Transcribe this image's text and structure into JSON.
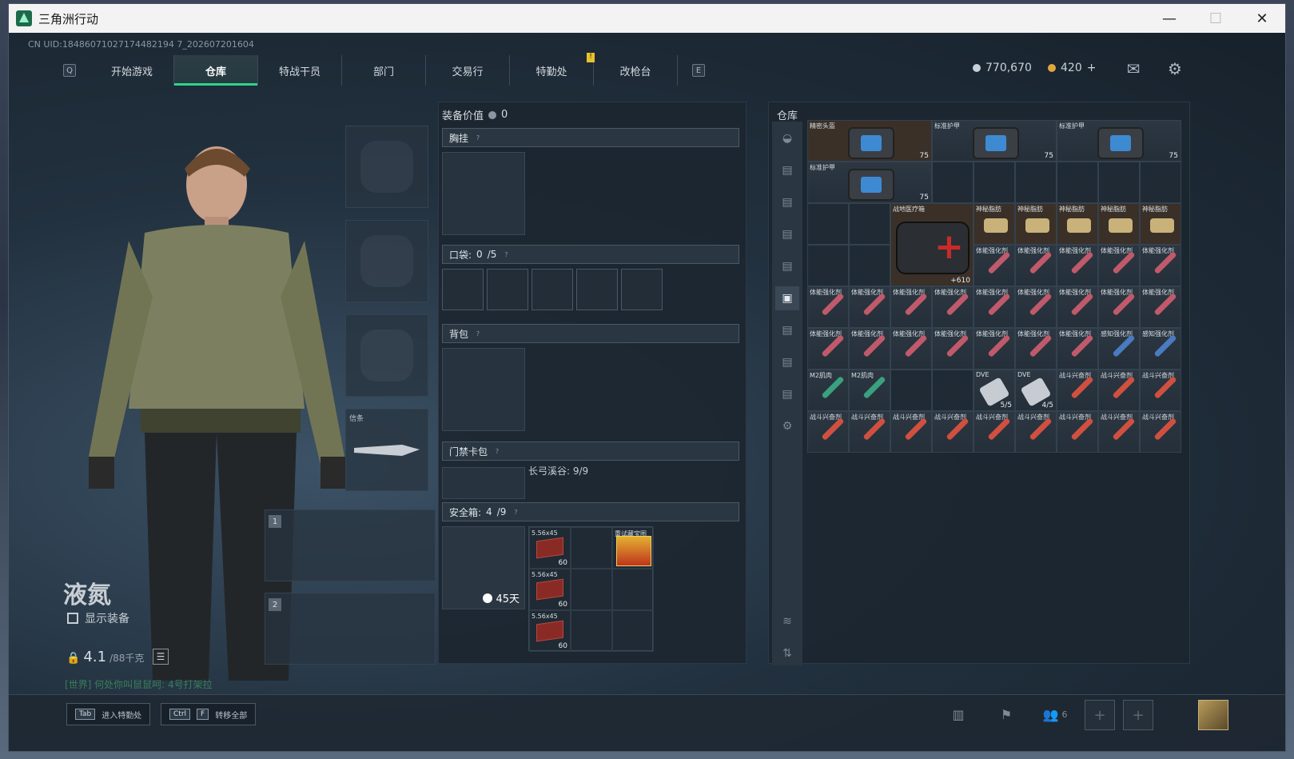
{
  "window": {
    "title": "三角洲行动",
    "minimize": "—",
    "maximize": "☐",
    "close": "✕"
  },
  "uid": "CN UID:18486071027174482194 7_202607201604",
  "nav": {
    "left_key": "Q",
    "right_key": "E",
    "tabs": [
      "开始游戏",
      "仓库",
      "特战干员",
      "部门",
      "交易行",
      "特勤处",
      "改枪台"
    ],
    "active_tab": "仓库",
    "badge": "!"
  },
  "currency": {
    "silver": "770,670",
    "gold": "420",
    "add": "+",
    "silver_color": "#c9d1d8",
    "gold_color": "#e0a640"
  },
  "character": {
    "name": "液氮",
    "show_equip": "显示装备",
    "weight_value": "4.1",
    "weight_max": "/88千克",
    "world_msg": "[世界] 何处你叫鼠鼠呵: 4号打架拉",
    "melee_label": "信条",
    "weapon_slot_1": "1",
    "weapon_slot_2": "2"
  },
  "equipment": {
    "value_label": "装备价值",
    "value": "0",
    "chest_rig": "胸挂",
    "pockets": "口袋:",
    "pockets_count": "0",
    "pockets_max": "/5",
    "backpack": "背包",
    "keycard": "门禁卡包",
    "keycard_name": "长弓溪谷: 9/9",
    "safebox": "安全箱:",
    "safebox_count": "4",
    "safebox_max": "/9",
    "safebox_days": "45天",
    "ammo_label": "5.56x45",
    "ammo_count": "60",
    "gift_label": "重试藏宝图"
  },
  "stash": {
    "title": "仓库",
    "items": {
      "helmet": "精密头盔",
      "armor": "标准护甲",
      "medkit": "战地医疗箱",
      "medkit_count": "+610",
      "mystery": "神秘脂肪",
      "stamina": "体能强化剂",
      "perception": "感知强化剂",
      "m2": "M2肌肉",
      "dve": "DVE",
      "combat": "战斗兴奋剂",
      "durability": "75",
      "dve_uses_1": "5/5",
      "dve_uses_2": "4/5"
    }
  },
  "bottom": {
    "tab_key": "Tab",
    "tab_hint": "进入特勤处",
    "ctrl_key": "Ctrl",
    "f_key": "F",
    "transfer_hint": "转移全部",
    "friends_count": "6"
  }
}
